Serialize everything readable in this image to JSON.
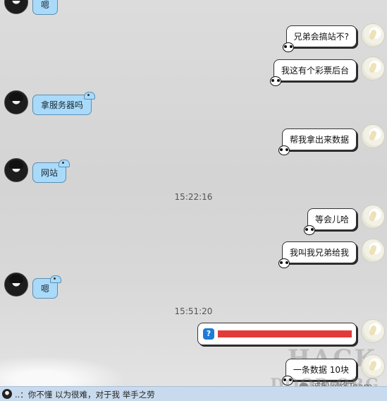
{
  "messages": [
    {
      "side": "left",
      "text": "嗯"
    },
    {
      "side": "right",
      "text": "兄弟会搞站不?"
    },
    {
      "side": "right",
      "text": "我这有个彩票后台"
    },
    {
      "side": "left",
      "text": "拿服务器吗"
    },
    {
      "side": "right",
      "text": "帮我拿出来数据"
    },
    {
      "side": "left",
      "text": "网站"
    },
    {
      "side": "time",
      "text": "15:22:16"
    },
    {
      "side": "right",
      "text": "等会儿哈"
    },
    {
      "side": "right",
      "text": "我叫我兄弟给我"
    },
    {
      "side": "left",
      "text": "嗯"
    },
    {
      "side": "time",
      "text": "15:51:20"
    },
    {
      "side": "right",
      "kind": "redacted-link"
    },
    {
      "side": "right",
      "text": "一条数据 10块"
    }
  ],
  "status_bar": {
    "text": "..：你不懂 以为很难，对于我 举手之劳"
  },
  "watermark": {
    "line1": "HACK",
    "line2": "DOOR.ORG",
    "badge": "诚殷网络Team"
  },
  "colors": {
    "left_bubble": "#a9dafa",
    "right_bubble": "#ffffff",
    "redaction": "#e23a3a",
    "status_bar": "#c8dbee"
  }
}
